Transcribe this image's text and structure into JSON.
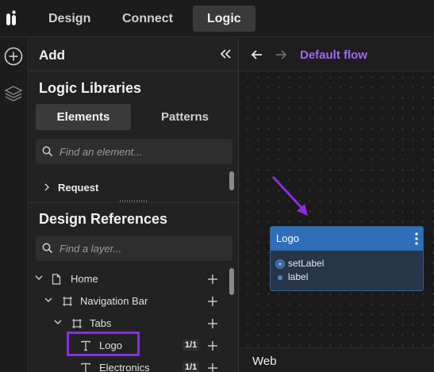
{
  "topbar": {
    "tabs": [
      {
        "label": "Design",
        "active": false
      },
      {
        "label": "Connect",
        "active": false
      },
      {
        "label": "Logic",
        "active": true
      }
    ]
  },
  "rail": {
    "icons": [
      "add-circle-icon",
      "layers-icon"
    ]
  },
  "panel": {
    "title": "Add",
    "logic_libraries": {
      "title": "Logic Libraries",
      "segments": [
        {
          "label": "Elements",
          "active": true
        },
        {
          "label": "Patterns",
          "active": false
        }
      ],
      "search_placeholder": "Find an element...",
      "items": [
        {
          "label": "Request"
        }
      ]
    },
    "design_references": {
      "title": "Design References",
      "search_placeholder": "Find a layer...",
      "tree": [
        {
          "label": "Home",
          "icon": "page-icon",
          "expanded": true
        },
        {
          "label": "Navigation Bar",
          "icon": "frame-icon",
          "expanded": true
        },
        {
          "label": "Tabs",
          "icon": "frame-icon",
          "expanded": true
        },
        {
          "label": "Logo",
          "icon": "text-icon",
          "badge": "1/1",
          "highlighted": true
        },
        {
          "label": "Electronics",
          "icon": "text-icon",
          "badge": "1/1"
        }
      ]
    }
  },
  "canvas": {
    "flow_name": "Default flow",
    "node": {
      "title": "Logo",
      "ports": [
        {
          "label": "setLabel"
        },
        {
          "label": "label"
        }
      ]
    },
    "footer_label": "Web"
  },
  "colors": {
    "accent_purple": "#8b2be2",
    "flow_name": "#a463f2",
    "node_header": "#2f6fb8"
  }
}
